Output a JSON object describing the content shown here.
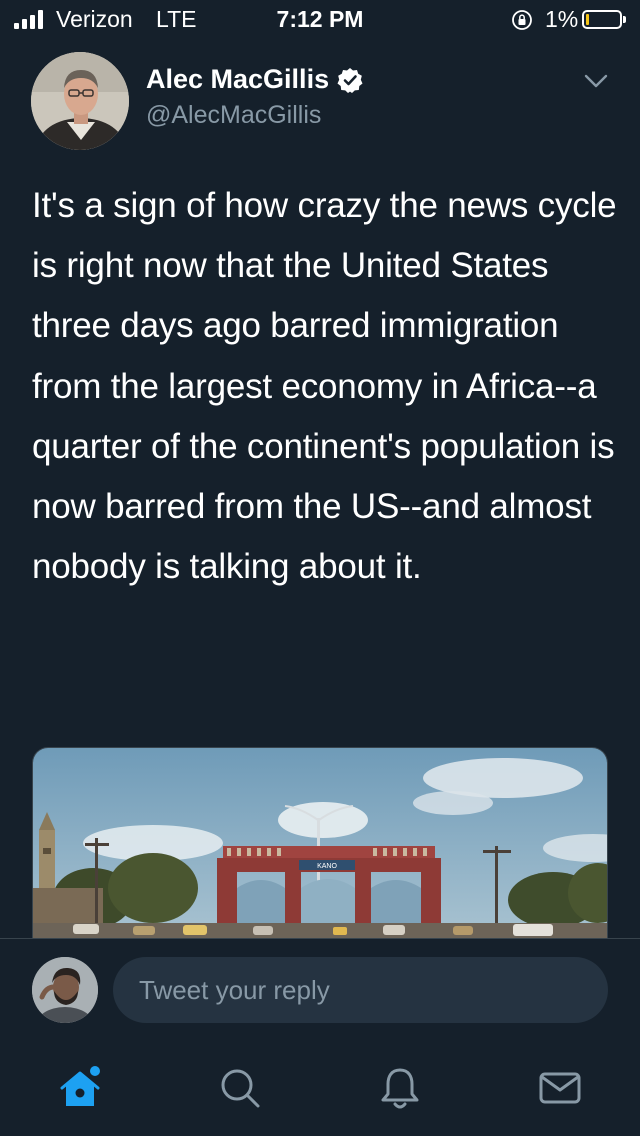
{
  "status_bar": {
    "carrier": "Verizon",
    "network": "LTE",
    "time": "7:12 PM",
    "battery_percent": "1%",
    "battery_level": 0.01,
    "signal_bars": 4,
    "icons": [
      "signal-icon",
      "orientation-lock-icon",
      "battery-icon"
    ]
  },
  "tweet": {
    "author": {
      "name": "Alec MacGillis",
      "handle": "@AlecMacGillis",
      "verified": true
    },
    "text": "It's a sign of how crazy the news cycle is right now that the United States three days ago barred immigration from the largest economy in Africa--a quarter of the continent's population is now barred from the US--and almost nobody is talking about it.",
    "media_present": true,
    "media_sign_text": "KANO"
  },
  "reply": {
    "placeholder": "Tweet your reply"
  },
  "tab_bar": {
    "tabs": [
      {
        "name": "home",
        "icon": "home-icon",
        "active": true,
        "has_badge": true
      },
      {
        "name": "search",
        "icon": "search-icon",
        "active": false
      },
      {
        "name": "notifications",
        "icon": "bell-icon",
        "active": false
      },
      {
        "name": "messages",
        "icon": "mail-icon",
        "active": false
      }
    ]
  },
  "colors": {
    "background": "#15202b",
    "text_primary": "#ffffff",
    "text_secondary": "#8899a6",
    "accent": "#1da1f2",
    "input_bg": "#253341",
    "divider": "#38444d"
  }
}
